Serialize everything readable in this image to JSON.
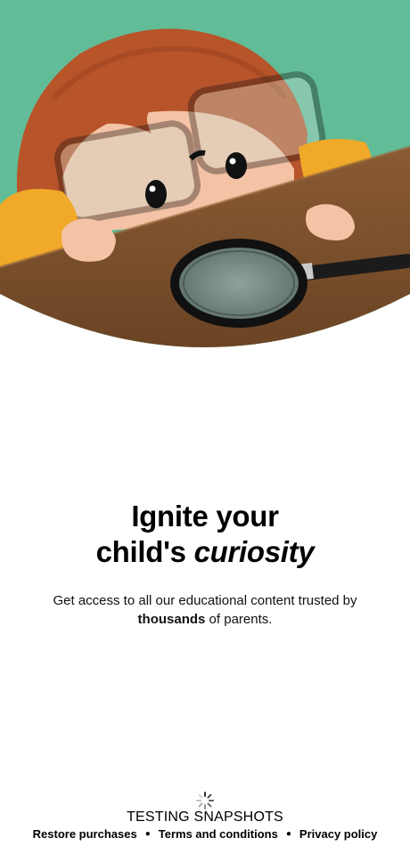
{
  "hero": {
    "image_description": "illustration"
  },
  "headline": {
    "line1": "Ignite your",
    "line2_prefix": "child's ",
    "line2_emphasis": "curiosity"
  },
  "subtitle": {
    "before": "Get access to all our educational content trusted by ",
    "bold": "thousands",
    "after": " of parents."
  },
  "status": {
    "spinner_icon": "loading-spinner-icon",
    "text": "TESTING SNAPSHOTS"
  },
  "footer": {
    "restore": "Restore purchases",
    "separator": "●",
    "terms": "Terms and conditions",
    "privacy": "Privacy policy"
  },
  "colors": {
    "background_green": "#5db893",
    "table_brown": "#7a4f2c",
    "hair": "#b8542a",
    "sleeve": "#f0a928",
    "text": "#000000"
  }
}
